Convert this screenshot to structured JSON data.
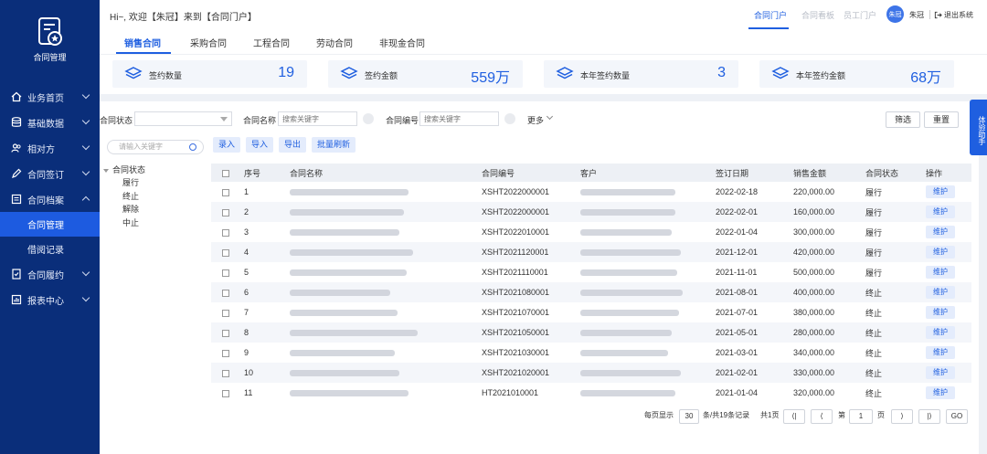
{
  "app": {
    "name": "合同管理"
  },
  "header": {
    "welcome": "Hi~, 欢迎【朱冠】来到【合同门户】",
    "nav": [
      "合同门户",
      "合同看板",
      "员工门户"
    ],
    "avatar_text": "朱冠",
    "user_name": "朱冠",
    "logout": "退出系统"
  },
  "sidebar": {
    "items": [
      {
        "label": "业务首页",
        "icon": "home-icon"
      },
      {
        "label": "基础数据",
        "icon": "database-icon"
      },
      {
        "label": "相对方",
        "icon": "users-icon"
      },
      {
        "label": "合同签订",
        "icon": "pen-icon"
      },
      {
        "label": "合同档案",
        "icon": "archive-icon"
      },
      {
        "label": "合同管理",
        "sub": true,
        "active": true
      },
      {
        "label": "借阅记录",
        "sub": true
      },
      {
        "label": "合同履约",
        "icon": "contract-icon"
      },
      {
        "label": "报表中心",
        "icon": "report-icon"
      }
    ]
  },
  "tabs": [
    "销售合同",
    "采购合同",
    "工程合同",
    "劳动合同",
    "非现金合同"
  ],
  "stats": [
    {
      "label": "签约数量",
      "value": "19"
    },
    {
      "label": "签约金额",
      "value": "559万"
    },
    {
      "label": "本年签约数量",
      "value": "3"
    },
    {
      "label": "本年签约金额",
      "value": "68万"
    }
  ],
  "filters": {
    "status_label": "合同状态",
    "name_label": "合同名称",
    "name_placeholder": "搜索关键字",
    "code_label": "合同编号",
    "code_placeholder": "搜索关键字",
    "more": "更多",
    "filter_btn": "筛选",
    "reset_btn": "重置"
  },
  "tree": {
    "search_placeholder": "请输入关键字",
    "root": "合同状态",
    "children": [
      "履行",
      "终止",
      "解除",
      "中止"
    ]
  },
  "actions": [
    "录入",
    "导入",
    "导出",
    "批量刷新"
  ],
  "table": {
    "columns": [
      "序号",
      "合同名称",
      "合同编号",
      "客户",
      "签订日期",
      "销售金额",
      "合同状态",
      "操作"
    ],
    "rows": [
      {
        "no": "1",
        "code": "XSHT2022000001",
        "date": "2022-02-18",
        "amount": "220,000.00",
        "status": "履行",
        "op": "维护"
      },
      {
        "no": "2",
        "code": "XSHT2022000001",
        "date": "2022-02-01",
        "amount": "160,000.00",
        "status": "履行",
        "op": "维护"
      },
      {
        "no": "3",
        "code": "XSHT2022010001",
        "date": "2022-01-04",
        "amount": "300,000.00",
        "status": "履行",
        "op": "维护"
      },
      {
        "no": "4",
        "code": "XSHT2021120001",
        "date": "2021-12-01",
        "amount": "420,000.00",
        "status": "履行",
        "op": "维护"
      },
      {
        "no": "5",
        "code": "XSHT2021110001",
        "date": "2021-11-01",
        "amount": "500,000.00",
        "status": "履行",
        "op": "维护"
      },
      {
        "no": "6",
        "code": "XSHT2021080001",
        "date": "2021-08-01",
        "amount": "400,000.00",
        "status": "终止",
        "op": "维护"
      },
      {
        "no": "7",
        "code": "XSHT2021070001",
        "date": "2021-07-01",
        "amount": "380,000.00",
        "status": "终止",
        "op": "维护"
      },
      {
        "no": "8",
        "code": "XSHT2021050001",
        "date": "2021-05-01",
        "amount": "280,000.00",
        "status": "终止",
        "op": "维护"
      },
      {
        "no": "9",
        "code": "XSHT2021030001",
        "date": "2021-03-01",
        "amount": "340,000.00",
        "status": "终止",
        "op": "维护"
      },
      {
        "no": "10",
        "code": "XSHT2021020001",
        "date": "2021-02-01",
        "amount": "330,000.00",
        "status": "终止",
        "op": "维护"
      },
      {
        "no": "11",
        "code": "HT2021010001",
        "date": "2021-01-04",
        "amount": "320,000.00",
        "status": "终止",
        "op": "维护"
      }
    ]
  },
  "pager": {
    "per_page_label": "每页显示",
    "per_page": "30",
    "total_text": "条/共19条记录",
    "pages_text": "共1页",
    "page_prefix": "第",
    "page": "1",
    "page_suffix": "页",
    "go": "GO"
  },
  "side_widget": "体验助手",
  "colors": {
    "sidebar": "#0a2e7a",
    "accent": "#1f5fe0",
    "active_sub": "#1d5be0"
  }
}
